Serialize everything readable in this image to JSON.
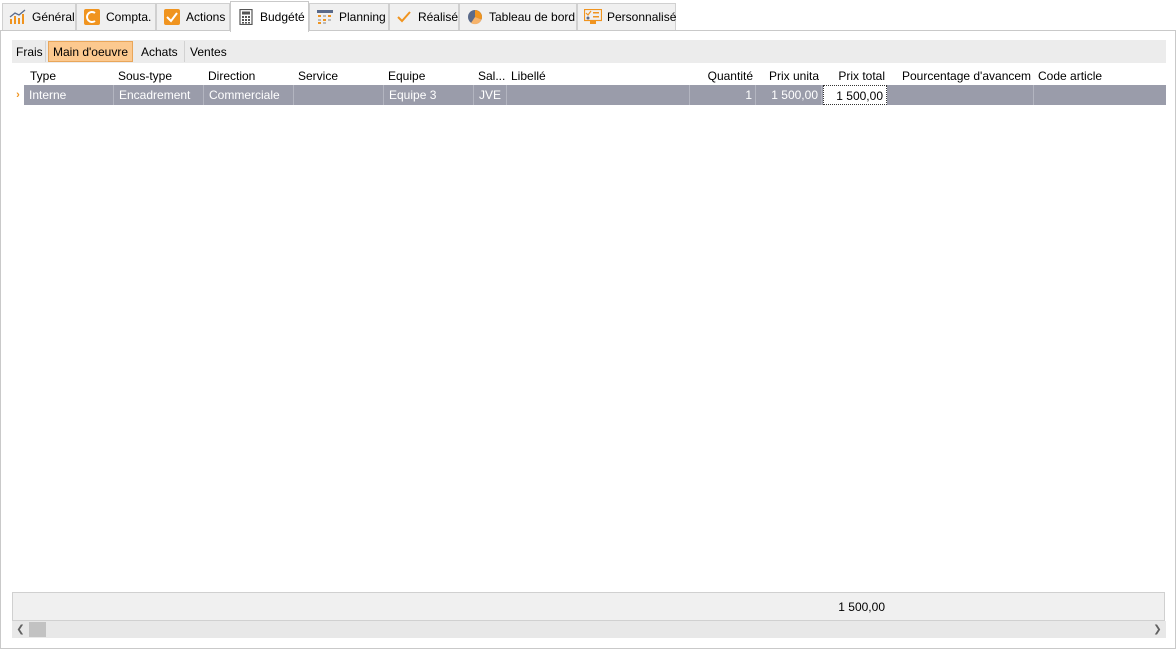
{
  "tabs": [
    {
      "label": "Général",
      "icon": "chart-icon"
    },
    {
      "label": "Compta.",
      "icon": "compta-icon"
    },
    {
      "label": "Actions",
      "icon": "checkbox-icon"
    },
    {
      "label": "Budgété",
      "icon": "calculator-icon"
    },
    {
      "label": "Planning",
      "icon": "planning-icon"
    },
    {
      "label": "Réalisé",
      "icon": "check-icon"
    },
    {
      "label": "Tableau de bord",
      "icon": "pie-chart-icon"
    },
    {
      "label": "Personnalisé",
      "icon": "personalize-icon"
    }
  ],
  "active_tab": "Budgété",
  "subtabs": [
    {
      "label": "Frais"
    },
    {
      "label": "Main d'oeuvre"
    },
    {
      "label": "Achats"
    },
    {
      "label": "Ventes"
    }
  ],
  "active_subtab": "Main d'oeuvre",
  "grid": {
    "columns": [
      "Type",
      "Sous-type",
      "Direction",
      "Service",
      "Equipe",
      "Sal...",
      "Libellé",
      "Quantité",
      "Prix unita",
      "Prix total",
      "Pourcentage d'avancem",
      "Code article"
    ],
    "rows": [
      [
        "Interne",
        "Encadrement",
        "Commerciale",
        "",
        "Equipe 3",
        "JVE",
        "",
        "1",
        "1 500,00",
        "1 500,00",
        "",
        ""
      ]
    ],
    "row_indicator": "›"
  },
  "footer": {
    "total": "1 500,00"
  },
  "colors": {
    "accent": "#f0941f",
    "selected_row": "#9a9caa",
    "active_subtab": "#fcc98f"
  }
}
